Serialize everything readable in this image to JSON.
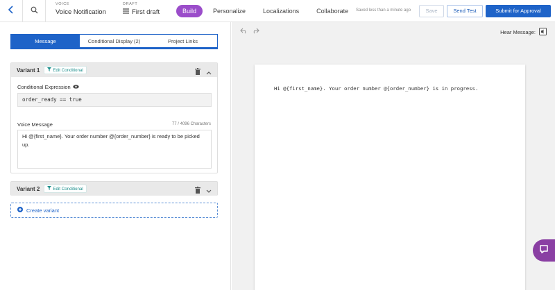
{
  "header": {
    "type_label": "VOICE",
    "type_value": "Voice Notification",
    "draft_label": "DRAFT",
    "draft_value": "First draft",
    "tabs": [
      {
        "label": "Build"
      },
      {
        "label": "Personalize"
      },
      {
        "label": "Localizations"
      },
      {
        "label": "Collaborate"
      }
    ],
    "saved_status": "Saved less than a minute ago",
    "save_label": "Save",
    "send_test_label": "Send Test",
    "submit_label": "Submit for Approval"
  },
  "left": {
    "tabs": [
      {
        "label": "Message"
      },
      {
        "label": "Conditional Display (2)"
      },
      {
        "label": "Project Links"
      }
    ],
    "variants": [
      {
        "title": "Variant 1",
        "edit_label": "Edit Conditional",
        "condition_label": "Conditional Expression",
        "condition_value": "order_ready == true",
        "message_label": "Voice Message",
        "char_count": "77 / 4096 Characters",
        "message_text": "Hi @{first_name}. Your order number @{order_number} is ready to be picked up."
      },
      {
        "title": "Variant 2",
        "edit_label": "Edit Conditional"
      }
    ],
    "create_variant_label": "Create variant"
  },
  "right": {
    "hear_label": "Hear Message:",
    "preview_text": "Hi @{first_name}. Your order number @{order_number} is in progress."
  },
  "colors": {
    "accent_purple": "#9b4dca",
    "primary_blue": "#1e63c8",
    "teal": "#1d8f8c"
  },
  "icons": [
    "back-arrow-icon",
    "search-icon",
    "menu-icon",
    "eye-icon",
    "trash-icon",
    "chevron-up-icon",
    "chevron-down-icon",
    "filter-icon",
    "plus-circle-icon",
    "undo-icon",
    "redo-icon",
    "speaker-icon",
    "chat-icon"
  ]
}
